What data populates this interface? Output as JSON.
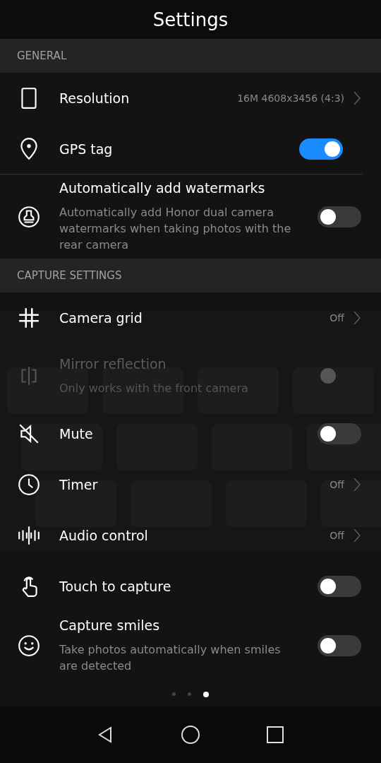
{
  "header": {
    "title": "Settings"
  },
  "sections": [
    {
      "title": "GENERAL",
      "rows": [
        {
          "kind": "value",
          "label": "Resolution",
          "value": "16M 4608x3456 (4:3)"
        },
        {
          "kind": "toggle",
          "label": "GPS tag",
          "on": true
        },
        {
          "kind": "toggle",
          "label": "Automatically add watermarks",
          "description": "Automatically add Honor dual camera watermarks when taking photos with the rear camera",
          "on": false
        }
      ]
    },
    {
      "title": "CAPTURE SETTINGS",
      "rows": [
        {
          "kind": "value",
          "label": "Camera grid",
          "value": "Off"
        },
        {
          "kind": "toggle",
          "label": "Mirror reflection",
          "description": "Only works with the front camera",
          "on": false,
          "disabled": true
        },
        {
          "kind": "toggle",
          "label": "Mute",
          "on": false
        },
        {
          "kind": "value",
          "label": "Timer",
          "value": "Off"
        },
        {
          "kind": "value",
          "label": "Audio control",
          "value": "Off"
        },
        {
          "kind": "toggle",
          "label": "Touch to capture",
          "on": false
        },
        {
          "kind": "toggle",
          "label": "Capture smiles",
          "description": "Take photos automatically when smiles are detected",
          "on": false
        }
      ]
    }
  ],
  "pager": [
    {
      "selected": false
    },
    {
      "selected": false
    },
    {
      "selected": true
    }
  ]
}
